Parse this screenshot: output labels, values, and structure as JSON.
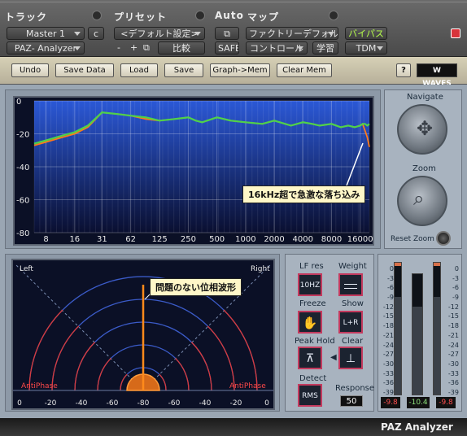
{
  "protools": {
    "track_label": "トラック",
    "preset_label": "プリセット",
    "auto_label": "Auto",
    "map_label": "マップ",
    "track_name": "Master 1",
    "track_channel": "c",
    "plugin_name": "PAZ- Analyzer",
    "preset_value": "<デフォルト設定>",
    "minus": "-",
    "plus": "+",
    "compare": "比較",
    "safe": "SAFE",
    "factory_default": "ファクトリーデフォルト",
    "control": "コントロール",
    "learn": "学習",
    "bypass": "バイパス",
    "format": "TDM"
  },
  "toolbar": {
    "undo": "Undo",
    "save_data": "Save Data",
    "load": "Load",
    "save": "Save",
    "graph_mem": "Graph->Mem",
    "clear_mem": "Clear Mem",
    "help": "?",
    "brand": "WAVES"
  },
  "spectrum": {
    "y_ticks": [
      "0",
      "-20",
      "-40",
      "-60",
      "-80"
    ],
    "x_ticks": [
      "8",
      "16",
      "31",
      "62",
      "125",
      "250",
      "500",
      "1000",
      "2000",
      "4000",
      "8000",
      "16000"
    ],
    "callout": "16kHz超で急激な落ち込み"
  },
  "chart_data": {
    "type": "line",
    "x_scale": "log",
    "x_tick_labels": [
      "8",
      "16",
      "31",
      "62",
      "125",
      "250",
      "500",
      "1000",
      "2000",
      "4000",
      "8000",
      "16000"
    ],
    "ylim": [
      -80,
      0
    ],
    "series": [
      {
        "color": "#ff7a1a",
        "x": [
          6,
          8,
          12,
          16,
          22,
          31,
          45,
          62,
          90,
          125,
          180,
          250,
          300,
          350,
          500,
          700,
          1000,
          1500,
          2000,
          3000,
          4000,
          5000,
          6000,
          8000,
          10000,
          12000,
          14000,
          16000,
          17000,
          18000,
          19000,
          20000
        ],
        "y": [
          -27,
          -25,
          -22,
          -20,
          -16,
          -7,
          -8,
          -9,
          -11,
          -12,
          -11,
          -10,
          -12,
          -13,
          -10,
          -12,
          -13,
          -14,
          -12,
          -15,
          -13,
          -14,
          -15,
          -14,
          -16,
          -15,
          -16,
          -15,
          -14,
          -18,
          -22,
          -28
        ]
      },
      {
        "color": "#4fd24a",
        "x": [
          6,
          8,
          12,
          16,
          22,
          31,
          45,
          62,
          90,
          125,
          180,
          250,
          300,
          350,
          500,
          700,
          1000,
          1500,
          2000,
          3000,
          4000,
          5000,
          6000,
          8000,
          10000,
          12000,
          14000,
          16000,
          17000,
          18000,
          19000,
          20000
        ],
        "y": [
          -26,
          -24,
          -21,
          -19,
          -15,
          -7,
          -8,
          -9,
          -10,
          -12,
          -11,
          -10,
          -12,
          -13,
          -10,
          -12,
          -13,
          -14,
          -12,
          -15,
          -13,
          -14,
          -15,
          -14,
          -16,
          -15,
          -16,
          -15,
          -14,
          -14,
          -15,
          -14
        ]
      }
    ]
  },
  "navigate": {
    "navigate_label": "Navigate",
    "zoom_label": "Zoom",
    "reset_zoom": "Reset Zoom"
  },
  "phase": {
    "left": "Left",
    "right": "Right",
    "anti_left": "AntiPhase",
    "anti_right": "AntiPhase",
    "scale": [
      "0",
      "-20",
      "-40",
      "-60",
      "-80",
      "-60",
      "-40",
      "-20",
      "0"
    ],
    "callout": "問題のない位相波形"
  },
  "controls": {
    "lf_res_label": "LF res",
    "lf_res_value": "10HZ",
    "weight_label": "Weight",
    "freeze_label": "Freeze",
    "show_label": "Show",
    "show_value": "L+R",
    "peak_hold_label": "Peak Hold",
    "clear_label": "Clear",
    "detect_label": "Detect",
    "detect_value": "RMS",
    "response_label": "Response",
    "response_value": "50"
  },
  "meters": {
    "scale": [
      "0",
      "-3",
      "-6",
      "-9",
      "-12",
      "-15",
      "-18",
      "-21",
      "-24",
      "-27",
      "-30",
      "-33",
      "-36",
      "-39"
    ],
    "left_value": "-9.8",
    "center_value": "-10.4",
    "right_value": "-9.8",
    "left_level": 0.74,
    "center_level": 0.73,
    "right_level": 0.74
  },
  "footer": {
    "title": "PAZ Analyzer"
  }
}
